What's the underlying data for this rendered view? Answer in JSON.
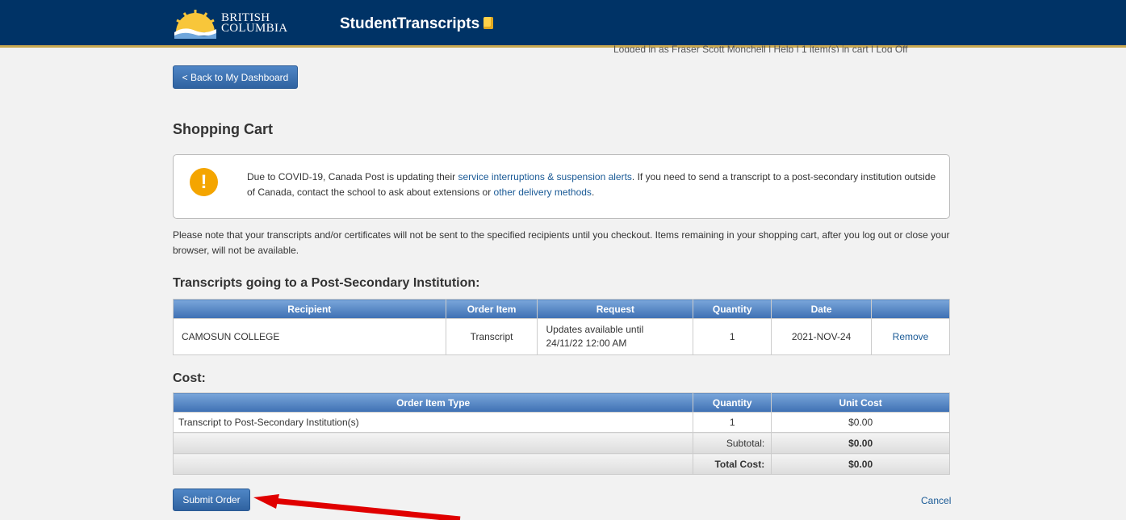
{
  "header": {
    "logo_line1": "BRITISH",
    "logo_line2": "COLUMBIA",
    "app_title": "StudentTranscripts",
    "user_nav": "Logged in as Fraser Scott Monchell  |  Help  |  1 item(s) in cart  |  Log Off"
  },
  "back_button": "< Back to My Dashboard",
  "page_title": "Shopping Cart",
  "alert": {
    "text1": "Due to COVID-19, Canada Post is updating their ",
    "link1": "service interruptions & suspension alerts",
    "text2": ". If you need to send a transcript to a post-secondary institution outside of Canada, contact the school to ask about extensions or ",
    "link2": "other delivery methods",
    "text3": "."
  },
  "note": "Please note that your transcripts and/or certificates will not be sent to the specified recipients until you checkout. Items remaining in your shopping cart, after you log out or close your browser, will not be available.",
  "transcripts": {
    "title": "Transcripts going to a Post-Secondary Institution:",
    "headers": [
      "Recipient",
      "Order Item",
      "Request",
      "Quantity",
      "Date"
    ],
    "row": {
      "recipient": "CAMOSUN COLLEGE",
      "order_item": "Transcript",
      "request_line1": "Updates available until",
      "request_line2": "24/11/22 12:00 AM",
      "quantity": "1",
      "date": "2021-NOV-24",
      "action": "Remove"
    }
  },
  "cost": {
    "title": "Cost:",
    "headers": [
      "Order Item Type",
      "Quantity",
      "Unit Cost"
    ],
    "row": {
      "type": "Transcript to Post-Secondary Institution(s)",
      "quantity": "1",
      "unit_cost": "$0.00"
    },
    "subtotal_label": "Subtotal:",
    "subtotal": "$0.00",
    "total_label": "Total Cost:",
    "total": "$0.00"
  },
  "submit_button": "Submit Order",
  "cancel_link": "Cancel",
  "colors": {
    "header_bg": "#003366",
    "accent_gold": "#c8a850",
    "button_blue": "#2f62a0",
    "arrow_red": "#e00000"
  }
}
